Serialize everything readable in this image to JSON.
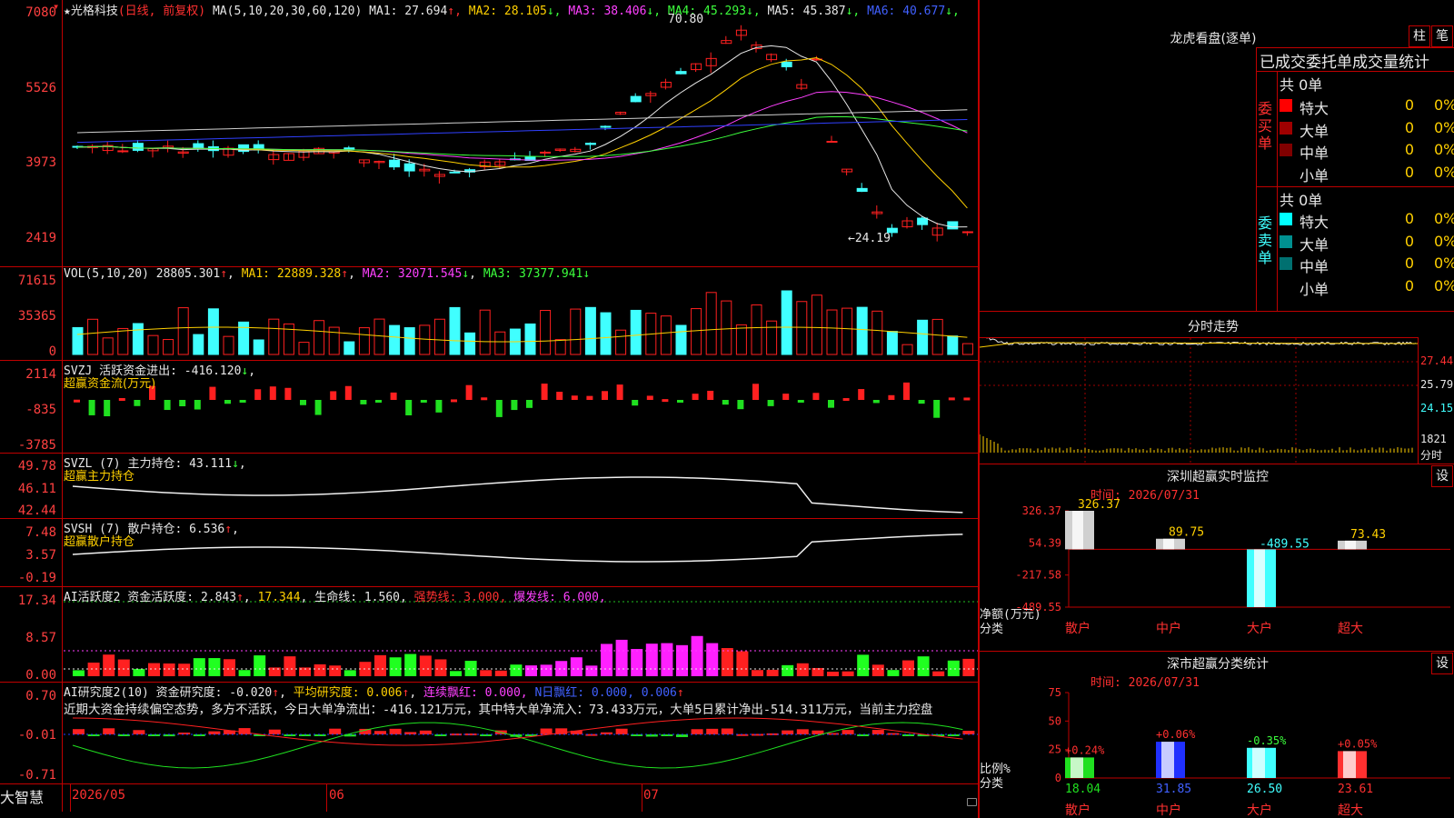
{
  "stock": {
    "name": "★光格科技",
    "mode": "(日线, 前复权)",
    "marker": "▾",
    "ma_params": "MA(5,10,20,30,60,120)",
    "ma": [
      {
        "label": "MA1:",
        "value": "27.694",
        "arrow": "↑",
        "color": "#e8e8e8"
      },
      {
        "label": "MA2:",
        "value": "28.105",
        "arrow": "↓",
        "color": "#ffd000"
      },
      {
        "label": "MA3:",
        "value": "38.406",
        "arrow": "↓",
        "color": "#ff40ff"
      },
      {
        "label": "MA4:",
        "value": "45.293",
        "arrow": "↓",
        "color": "#3cff3c"
      },
      {
        "label": "MA5:",
        "value": "45.387",
        "arrow": "↓",
        "color": "#e8e8e8"
      },
      {
        "label": "MA6:",
        "value": "40.677",
        "arrow": "↓",
        "color": "#4060ff"
      }
    ],
    "high_marker": "70.80",
    "low_marker": "←24.19",
    "price_axis": [
      "7080",
      "5526",
      "3973",
      "2419"
    ]
  },
  "volume": {
    "header": "VOL(5,10,20)",
    "value": "28805.301",
    "value_arrow": "↑",
    "ma1": "MA1: 22889.328",
    "ma1_arrow": "↑",
    "ma2": "MA2: 32071.545",
    "ma2_arrow": "↓",
    "ma3": "MA3: 37377.941",
    "ma3_arrow": "↓",
    "axis": [
      "71615",
      "35365",
      "0"
    ]
  },
  "svzj": {
    "header": "SVZJ  活跃资金进出: -416.120",
    "arrow": "↓",
    "sub": "超赢资金流(万元)",
    "axis": [
      "2114",
      "-835",
      "-3785"
    ]
  },
  "svzl": {
    "header": "SVZL (7) 主力持仓: 43.111",
    "arrow": "↓",
    "tail": ",",
    "sub": "超赢主力持仓",
    "axis": [
      "49.78",
      "46.11",
      "42.44"
    ]
  },
  "svsh": {
    "header": "SVSH (7) 散户持仓: 6.536",
    "arrow": "↑",
    "tail": ",",
    "sub": "超赢散户持仓",
    "axis": [
      "7.48",
      "3.57",
      "-0.19"
    ]
  },
  "ai_active": {
    "header": "AI活跃度2 资金活跃度: 2.843",
    "arrow": "↑",
    "v2": "17.344",
    "life": "生命线: 1.560,",
    "strong": "强势线: 3.000,",
    "burst": "爆发线: 6.000,",
    "axis": [
      "17.34",
      "8.57",
      "0.00"
    ]
  },
  "ai_research": {
    "header": "AI研究度2(10) 资金研究度: -0.020",
    "arrow": "↑",
    "avg": "平均研究度: 0.006",
    "avg_arrow": "↑",
    "cont": "连续飘红: 0.000,",
    "nday": "N日飘红: 0.000, 0.006",
    "nday_arrow": "↑",
    "summary": "近期大资金持续偏空态势，多方不活跃，今日大单净流出：-416.121万元，其中特大单净流入：73.433万元，大单5日累计净出-514.311万元，当前主力控盘",
    "axis": [
      "0.70",
      "-0.01",
      "-0.71"
    ]
  },
  "date_axis": {
    "brand": "大智慧",
    "labels": [
      "2026/05",
      "06",
      "07"
    ]
  },
  "dragon_tiger": {
    "title": "龙虎看盘(逐单)",
    "btn_bar": "柱",
    "btn_line": "笔",
    "subtitle": "已成交委托单成交量统计",
    "buy_label": "委买单",
    "sell_label": "委卖单",
    "buy_total": "共 0单",
    "sell_total": "共 0单",
    "buy_rows": [
      {
        "name": "特大",
        "count": "0",
        "pct": "0%",
        "color": "#ff0000"
      },
      {
        "name": "大单",
        "count": "0",
        "pct": "0%",
        "color": "#a00000"
      },
      {
        "name": "中单",
        "count": "0",
        "pct": "0%",
        "color": "#800000"
      },
      {
        "name": "小单",
        "count": "0",
        "pct": "0%",
        "color": "#000000"
      }
    ],
    "sell_rows": [
      {
        "name": "特大",
        "count": "0",
        "pct": "0%",
        "color": "#00ffff"
      },
      {
        "name": "大单",
        "count": "0",
        "pct": "0%",
        "color": "#009090"
      },
      {
        "name": "中单",
        "count": "0",
        "pct": "0%",
        "color": "#007070"
      },
      {
        "name": "小单",
        "count": "0",
        "pct": "0%",
        "color": "#000000"
      }
    ]
  },
  "intraday": {
    "title": "分时走势",
    "axis": [
      "27.44",
      "25.79",
      "24.15",
      "1821",
      "分时"
    ]
  },
  "sz_monitor": {
    "title": "深圳超赢实时监控",
    "settings": "设",
    "time": "时间: 2026/07/31",
    "axis": [
      "326.37",
      "54.39",
      "-217.58",
      "-489.55"
    ],
    "y_title": "净额(万元)",
    "x_title": "分类",
    "categories": [
      "散户",
      "中户",
      "大户",
      "超大"
    ],
    "values": [
      326.37,
      89.75,
      -489.55,
      73.43
    ],
    "value_labels": [
      "326.37",
      "89.75",
      "-489.55",
      "73.43"
    ]
  },
  "sz_class": {
    "title": "深市超赢分类统计",
    "settings": "设",
    "time": "时间: 2026/07/31",
    "axis": [
      "75",
      "50",
      "25",
      "0"
    ],
    "y_title": "比例%",
    "x_title": "分类",
    "categories": [
      "散户",
      "中户",
      "大户",
      "超大"
    ],
    "values": [
      18.04,
      31.85,
      26.5,
      23.61
    ],
    "value_labels": [
      "18.04",
      "31.85",
      "26.50",
      "23.61"
    ],
    "changes": [
      "+0.24%",
      "+0.06%",
      "-0.35%",
      "+0.05%"
    ]
  },
  "chart_data": {
    "type": "bar",
    "title": "深圳超赢实时监控",
    "categories": [
      "散户",
      "中户",
      "大户",
      "超大"
    ],
    "series": [
      {
        "values": [
          326.37,
          89.75,
          -489.55,
          73.43
        ]
      }
    ],
    "ylabel": "净额(万元)",
    "xlabel": "分类",
    "ylim": [
      -489.55,
      326.37
    ]
  }
}
